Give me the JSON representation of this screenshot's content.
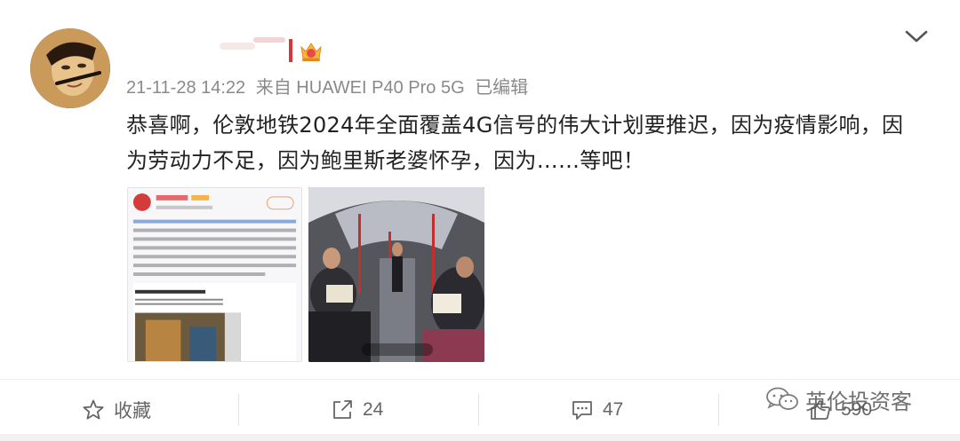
{
  "post": {
    "timestamp": "21-11-28 14:22",
    "source": "来自 HUAWEI P40 Pro 5G",
    "edited": "已编辑",
    "text_line1": "恭喜啊，伦敦地铁2024年全面覆盖4G信号的伟大计划要推迟，因为疫情影响，因",
    "text_line2": "为劳动力不足，因为鲍里斯老婆怀孕，因为……等吧！"
  },
  "actions": {
    "favorite_label": "收藏",
    "repost_count": "24",
    "comment_count": "47",
    "like_count": "590"
  },
  "watermark": {
    "text": "英伦投资客"
  },
  "icons": {
    "menu": "chevron-down-icon",
    "vip": "vip-crown-icon",
    "favorite": "star-icon",
    "repost": "repost-icon",
    "comment": "comment-icon",
    "like": "thumbs-up-icon",
    "wechat": "wechat-icon"
  },
  "colors": {
    "accent": "#d8353a",
    "meta_text": "#8a8a8a",
    "body_text": "#222222"
  }
}
